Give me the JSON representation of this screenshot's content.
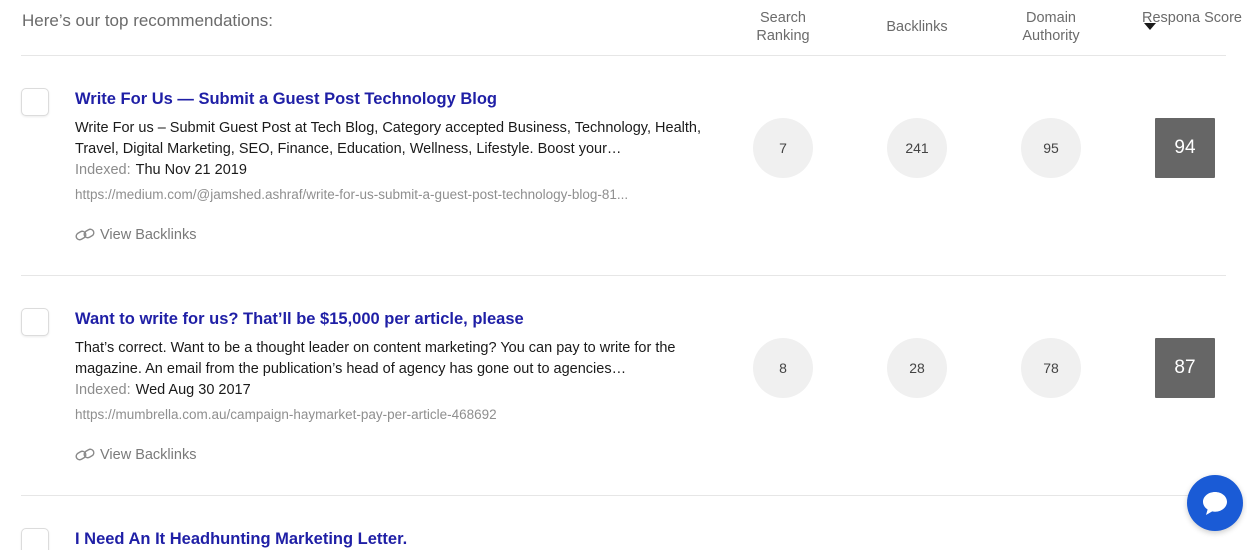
{
  "header": {
    "title": "Here’s our top recommendations:",
    "columns": {
      "search_ranking": "Search Ranking",
      "backlinks": "Backlinks",
      "domain_authority": "Domain Authority",
      "respona_score": "Respona Score"
    }
  },
  "results": [
    {
      "title": "Write For Us — Submit a Guest Post Technology Blog",
      "description": "Write For us – Submit Guest Post at Tech Blog, Category accepted Business, Technology, Health, Travel, Digital Marketing, SEO, Finance, Education, Wellness, Lifestyle. Boost your…",
      "indexed_label": "Indexed:",
      "indexed_date": "Thu Nov 21 2019",
      "url": "https://medium.com/@jamshed.ashraf/write-for-us-submit-a-guest-post-technology-blog-81...",
      "backlinks_link": "View Backlinks",
      "search_ranking": "7",
      "backlinks": "241",
      "domain_authority": "95",
      "score": "94"
    },
    {
      "title": "Want to write for us? That’ll be $15,000 per article, please",
      "description": "That’s correct. Want to be a thought leader on content marketing? You can pay to write for the magazine. An email from the publication’s head of agency has gone out to agencies…",
      "indexed_label": "Indexed:",
      "indexed_date": "Wed Aug 30 2017",
      "url": "https://mumbrella.com.au/campaign-haymarket-pay-per-article-468692",
      "backlinks_link": "View Backlinks",
      "search_ranking": "8",
      "backlinks": "28",
      "domain_authority": "78",
      "score": "87"
    },
    {
      "title": "I Need An It Headhunting Marketing Letter."
    }
  ],
  "colors": {
    "title_link": "#1f1fa6",
    "score_bg": "#666666",
    "chat_button": "#1a5bd6"
  },
  "icons": {
    "sort": "caret-down-icon",
    "backlinks": "link-icon",
    "chat": "chat-bubble-icon"
  }
}
